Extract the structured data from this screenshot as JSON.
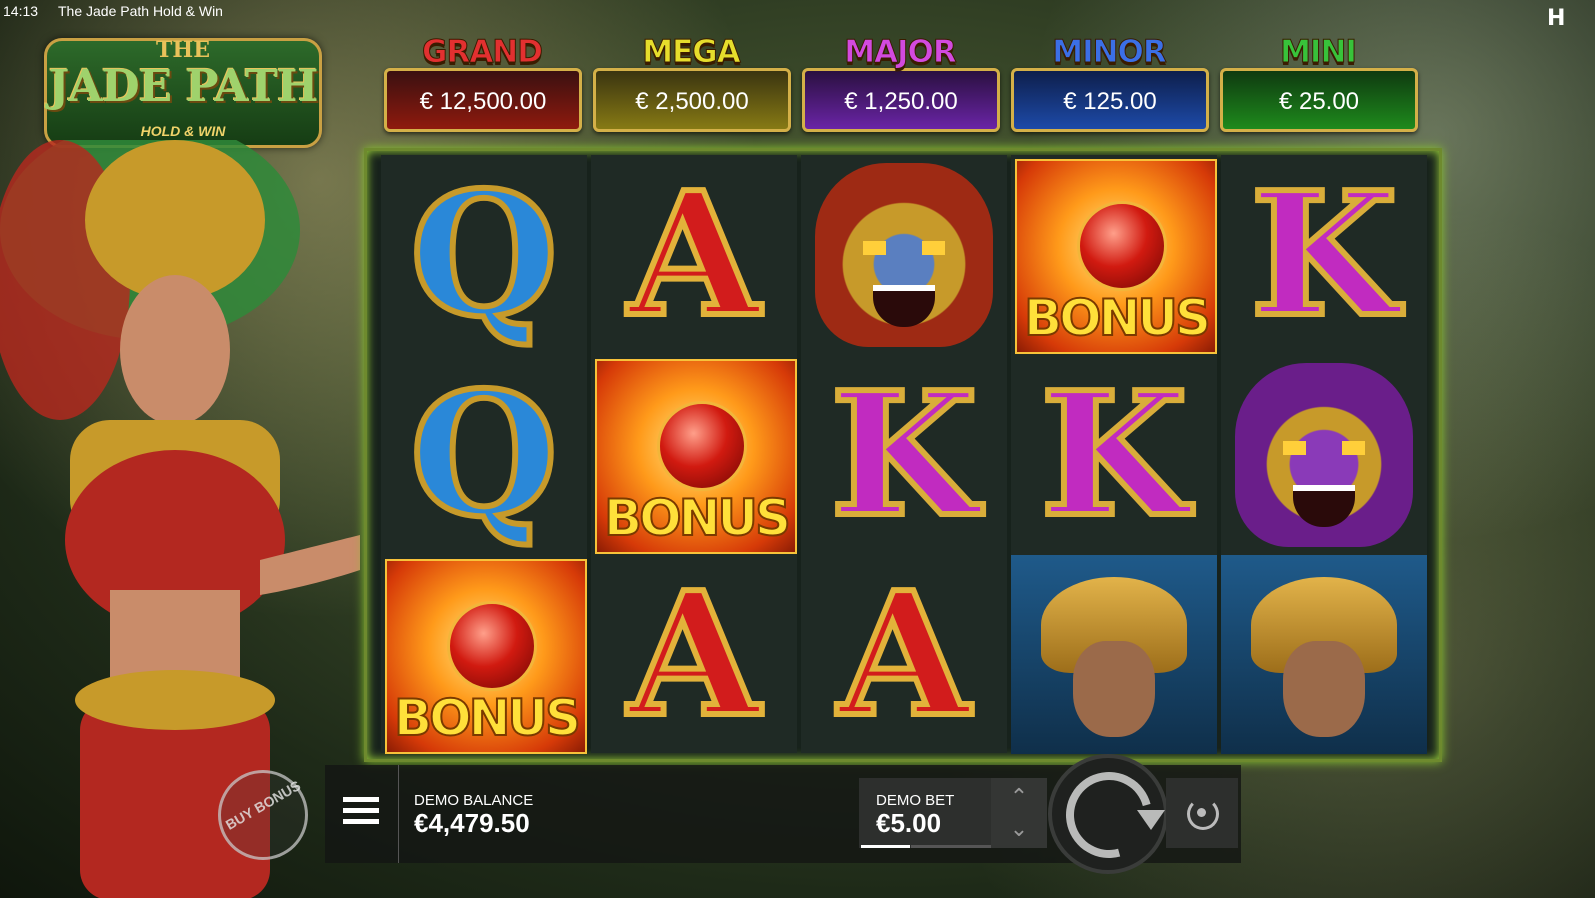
{
  "status": {
    "time": "14:13",
    "title": "The Jade Path Hold & Win",
    "brand_icon": "hacksaw-h-icon"
  },
  "logo": {
    "the": "THE",
    "main": "JADE PATH",
    "sub": "HOLD & WIN"
  },
  "jackpots": [
    {
      "name": "GRAND",
      "value": "€ 12,500.00",
      "name_color": "#e23030",
      "box": "linear-gradient(#3a1010,#8f1a0e)"
    },
    {
      "name": "MEGA",
      "value": "€ 2,500.00",
      "name_color": "#e6dd2c",
      "box": "linear-gradient(#3a3410,#877a14)"
    },
    {
      "name": "MAJOR",
      "value": "€ 1,250.00",
      "name_color": "#d24adf",
      "box": "linear-gradient(#2a1040,#6a24a6)"
    },
    {
      "name": "MINOR",
      "value": "€ 125.00",
      "name_color": "#3b6fe6",
      "box": "linear-gradient(#0e1f4c,#1d4aa8)"
    },
    {
      "name": "MINI",
      "value": "€ 25.00",
      "name_color": "#38c23a",
      "box": "linear-gradient(#0f3a10,#1e8a1c)"
    }
  ],
  "reels": [
    [
      {
        "type": "letter",
        "letter": "Q"
      },
      {
        "type": "letter",
        "letter": "Q"
      },
      {
        "type": "bonus",
        "text": "BONUS"
      }
    ],
    [
      {
        "type": "letter",
        "letter": "A"
      },
      {
        "type": "bonus",
        "text": "BONUS"
      },
      {
        "type": "letter",
        "letter": "A"
      }
    ],
    [
      {
        "type": "mask",
        "variant": "eagle"
      },
      {
        "type": "letter",
        "letter": "K"
      },
      {
        "type": "letter",
        "letter": "A"
      }
    ],
    [
      {
        "type": "bonus",
        "text": "BONUS"
      },
      {
        "type": "letter",
        "letter": "K"
      },
      {
        "type": "warrior"
      }
    ],
    [
      {
        "type": "letter",
        "letter": "K"
      },
      {
        "type": "mask",
        "variant": "jaguar"
      },
      {
        "type": "warrior"
      }
    ]
  ],
  "balance": {
    "label": "DEMO BALANCE",
    "value": "€4,479.50"
  },
  "bet": {
    "label": "DEMO BET",
    "value": "€5.00",
    "level": 0.38
  },
  "buy_bonus": {
    "label": "BUY BONUS"
  },
  "icons": {
    "menu": "menu-icon",
    "spin": "spin-icon",
    "autoplay": "autoplay-icon",
    "up": "chevron-up-icon",
    "down": "chevron-down-icon"
  }
}
